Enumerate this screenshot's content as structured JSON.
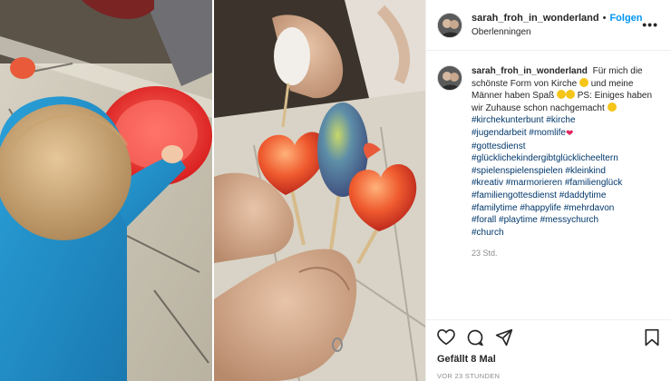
{
  "post": {
    "username": "sarah_froh_in_wonderland",
    "separator": "•",
    "follow_label": "Folgen",
    "location": "Oberlenningen",
    "more_icon": "more-options-icon"
  },
  "caption": {
    "username": "sarah_froh_in_wonderland",
    "text_part1": "Für mich die schönste Form von Kirche",
    "text_part2": "und meine Männer haben Spaß",
    "text_part3": "PS: Einiges haben wir Zuhause schon nachgemacht",
    "tags": [
      "#kirchekunterbunt",
      "#kirche",
      "#jugendarbeit",
      "#momlife",
      "#gottesdienst",
      "#glücklichekindergibtglücklicheeltern",
      "#spielenspielenspielen",
      "#kleinkind",
      "#kreativ",
      "#marmorieren",
      "#familienglück",
      "#familiengottesdienst",
      "#daddytime",
      "#familytime",
      "#happylife",
      "#mehrdavon",
      "#forall",
      "#playtime",
      "#messychurch",
      "#church"
    ],
    "age": "23 Std."
  },
  "actions": {
    "icons": [
      "heart-icon",
      "comment-icon",
      "share-icon",
      "bookmark-icon"
    ],
    "likes": "Gefällt 8 Mal",
    "timestamp": "VOR 23 STUNDEN"
  },
  "colors": {
    "link": "#00376b",
    "follow": "#0095f6",
    "muted": "#8e8e8e"
  }
}
